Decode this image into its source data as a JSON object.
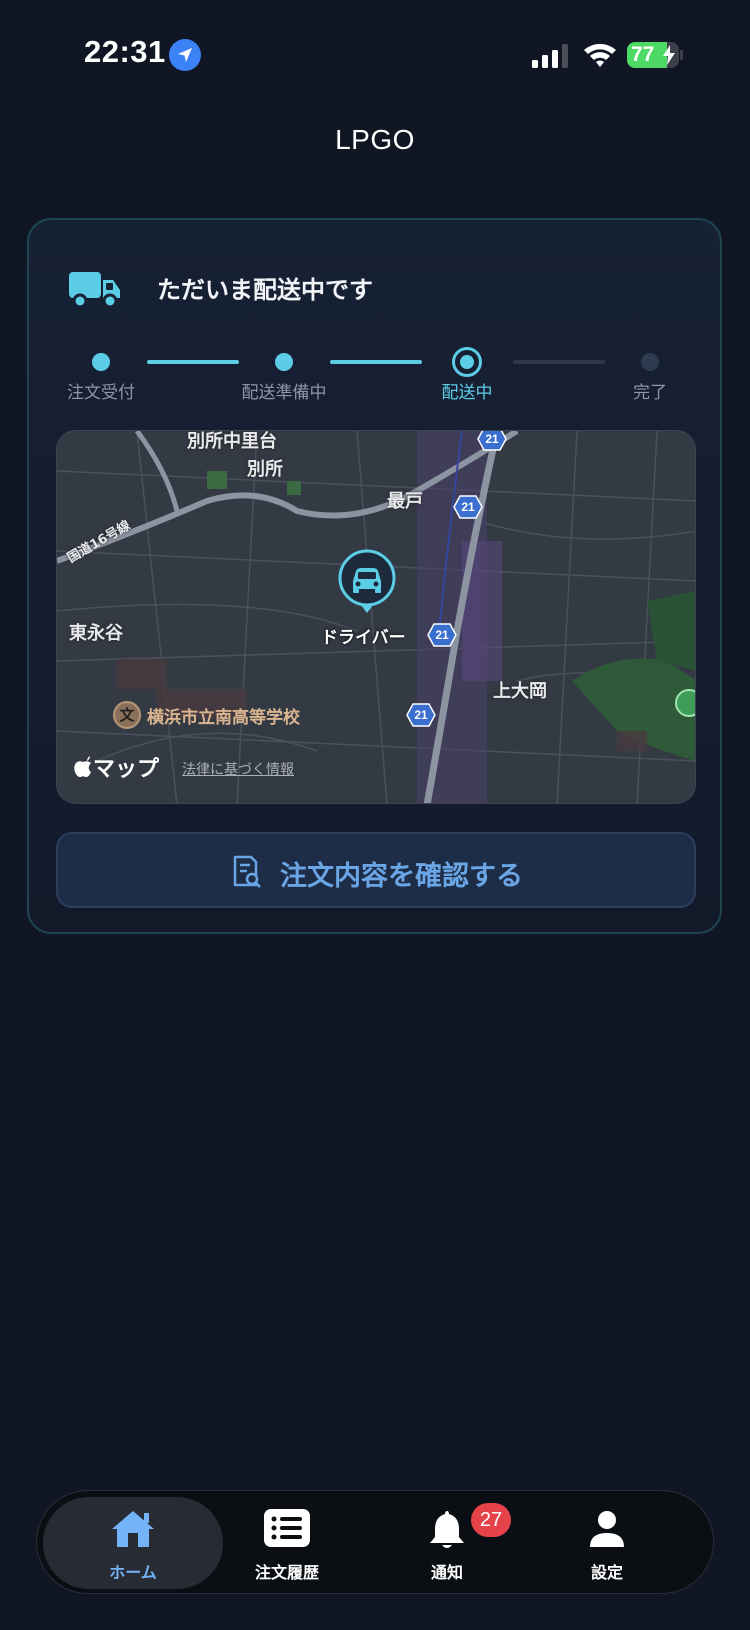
{
  "status_bar": {
    "time": "22:31",
    "battery": "77",
    "battery_level": 0.77,
    "icons": [
      "location-arrow-icon",
      "cellular-signal-icon",
      "wifi-icon",
      "battery-charging-icon"
    ]
  },
  "app": {
    "title": "LPGO"
  },
  "delivery": {
    "status_title": "ただいま配送中です",
    "status_icon": "truck-icon",
    "steps": [
      {
        "label": "注文受付",
        "state": "done"
      },
      {
        "label": "配送準備中",
        "state": "done"
      },
      {
        "label": "配送中",
        "state": "current"
      },
      {
        "label": "完了",
        "state": "pending"
      }
    ]
  },
  "map": {
    "place_labels": {
      "top": "別所中里台",
      "bessho": "別所",
      "mosto": "最戸",
      "higashinagaya": "東永谷",
      "kamiooka": "上大岡",
      "road16": "国道16号線"
    },
    "route_number": "21",
    "driver_label": "ドライバー",
    "school_label": "横浜市立南高等学校",
    "school_icon_glyph": "文",
    "attribution": "マップ",
    "legal": "法律に基づく情報"
  },
  "confirm_button": {
    "label": "注文内容を確認する",
    "icon": "document-search-icon"
  },
  "tab_bar": {
    "items": [
      {
        "label": "ホーム",
        "icon": "home-icon",
        "active": true
      },
      {
        "label": "注文履歴",
        "icon": "order-list-icon",
        "active": false
      },
      {
        "label": "通知",
        "icon": "bell-icon",
        "active": false,
        "badge": "27"
      },
      {
        "label": "設定",
        "icon": "person-icon",
        "active": false
      }
    ]
  },
  "colors": {
    "background": "#101624",
    "accent": "#5ccde6",
    "button_text": "#6aa5e6",
    "badge": "#e5424a",
    "tab_active": "#74b3f7"
  }
}
